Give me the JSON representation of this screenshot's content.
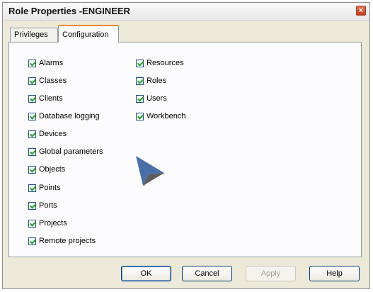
{
  "dialog": {
    "title": "Role Properties -ENGINEER",
    "close_glyph": "×"
  },
  "tabs": [
    {
      "label": "Privileges",
      "active": false
    },
    {
      "label": "Configuration",
      "active": true
    }
  ],
  "checkboxes_left": [
    {
      "label": "Alarms",
      "checked": true
    },
    {
      "label": "Classes",
      "checked": true
    },
    {
      "label": "Clients",
      "checked": true
    },
    {
      "label": "Database logging",
      "checked": true
    },
    {
      "label": "Devices",
      "checked": true
    },
    {
      "label": "Global parameters",
      "checked": true
    },
    {
      "label": "Objects",
      "checked": true
    },
    {
      "label": "Points",
      "checked": true
    },
    {
      "label": "Ports",
      "checked": true
    },
    {
      "label": "Projects",
      "checked": true
    },
    {
      "label": "Remote projects",
      "checked": true
    }
  ],
  "checkboxes_right": [
    {
      "label": "Resources",
      "checked": true
    },
    {
      "label": "Roles",
      "checked": true
    },
    {
      "label": "Users",
      "checked": true
    },
    {
      "label": "Workbench",
      "checked": true
    }
  ],
  "buttons": {
    "ok": "OK",
    "cancel": "Cancel",
    "apply": "Apply",
    "help": "Help"
  },
  "icons": {
    "cursor": "mouse-pointer-icon",
    "close": "close-icon",
    "check": "checkmark-icon"
  },
  "colors": {
    "window_bg": "#ece9d8",
    "panel_bg": "#fcfcfe",
    "tab_accent": "#e68b2c",
    "check": "#21a121",
    "cursor": "#4a6fa8"
  }
}
